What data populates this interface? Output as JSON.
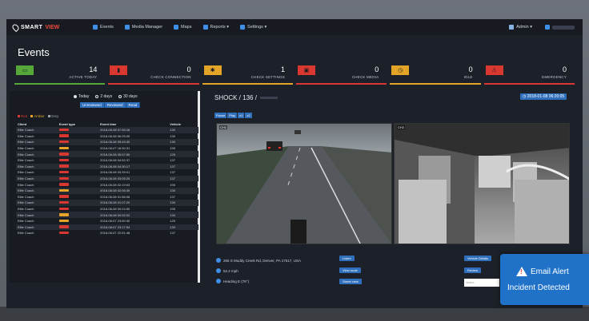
{
  "app": {
    "logo_a": "SMART",
    "logo_b": "VIEW",
    "icon": "map-pin-icon"
  },
  "nav": {
    "items": [
      {
        "label": "Events",
        "icon": "events-icon"
      },
      {
        "label": "Media Manager",
        "icon": "media-icon"
      },
      {
        "label": "Maps",
        "icon": "map-icon"
      },
      {
        "label": "Reports ▾",
        "icon": "reports-icon"
      },
      {
        "label": "Settings ▾",
        "icon": "settings-icon"
      }
    ],
    "admin": "Admin ▾"
  },
  "page": {
    "title": "Events"
  },
  "stats": [
    {
      "value": "14",
      "label": "ACTIVE TODAY",
      "color": "#57a83a"
    },
    {
      "value": "0",
      "label": "CHECK CONNECTION",
      "color": "#d8382f"
    },
    {
      "value": "1",
      "label": "CHECK SETTINGS",
      "color": "#e3a428"
    },
    {
      "value": "0",
      "label": "CHECK MEDIA",
      "color": "#d8382f"
    },
    {
      "value": "0",
      "label": "IDLE",
      "color": "#e3a428"
    },
    {
      "value": "0",
      "label": "EMERGENCY",
      "color": "#d8382f"
    }
  ],
  "filters": {
    "options": [
      "Today",
      "2 days",
      "30 days"
    ],
    "selected": 0
  },
  "tabs": [
    "Unreviewed",
    "Reviewed",
    "Read"
  ],
  "legend": [
    {
      "label": "Red",
      "color": "#d8382f"
    },
    {
      "label": "Amber",
      "color": "#e3a428"
    },
    {
      "label": "Grey",
      "color": "#9aa1aa"
    }
  ],
  "table": {
    "headers": [
      "Client",
      "Event type",
      "Event time",
      "Vehicle"
    ],
    "rows": [
      {
        "client": "Elite Coach",
        "type": "red",
        "time": "2018-08-08 07:30:16",
        "vehicle": "130"
      },
      {
        "client": "Elite Coach",
        "type": "red",
        "time": "2018-08-08 06:25:05",
        "vehicle": "130"
      },
      {
        "client": "Elite Coach",
        "type": "red",
        "time": "2018-08-08 05:45:30",
        "vehicle": "130"
      },
      {
        "client": "Elite Coach",
        "type": "amb",
        "time": "2018-08-07 18:30:31",
        "vehicle": "195"
      },
      {
        "client": "Elite Coach",
        "type": "red",
        "time": "2018-08-08 05:07:50",
        "vehicle": "125"
      },
      {
        "client": "Elite Coach",
        "type": "red",
        "time": "2018-08-08 04:52:37",
        "vehicle": "137"
      },
      {
        "client": "Elite Coach",
        "type": "red",
        "time": "2018-08-08 04:30:17",
        "vehicle": "137"
      },
      {
        "client": "Elite Coach",
        "type": "red",
        "time": "2018-08-08 03:39:01",
        "vehicle": "137"
      },
      {
        "client": "Elite Coach",
        "type": "red",
        "time": "2018-08-08 03:05:20",
        "vehicle": "137"
      },
      {
        "client": "Elite Coach",
        "type": "red",
        "time": "2018-08-08 02:19:03",
        "vehicle": "195"
      },
      {
        "client": "Elite Coach",
        "type": "amb",
        "time": "2018-08-08 02:06:30",
        "vehicle": "130"
      },
      {
        "client": "Elite Coach",
        "type": "red",
        "time": "2018-08-08 01:56:06",
        "vehicle": "137"
      },
      {
        "client": "Elite Coach",
        "type": "red",
        "time": "2018-08-08 01:07:20",
        "vehicle": "130"
      },
      {
        "client": "Elite Coach",
        "type": "red",
        "time": "2018-08-08 00:24:50",
        "vehicle": "195"
      },
      {
        "client": "Elite Coach",
        "type": "amb",
        "time": "2018-08-08 00:02:02",
        "vehicle": "130"
      },
      {
        "client": "Elite Coach",
        "type": "amb",
        "time": "2018-08-07 23:50:30",
        "vehicle": "125"
      },
      {
        "client": "Elite Coach",
        "type": "red",
        "time": "2018-08-07 23:17:54",
        "vehicle": "130"
      },
      {
        "client": "Elite Coach",
        "type": "red",
        "time": "2018-08-07 22:51:48",
        "vehicle": "137"
      }
    ]
  },
  "event": {
    "title": "SHOCK / 136 /",
    "date": "2018-01-08 06:20:05",
    "controls": [
      "Pause",
      "Play",
      "x1",
      "x2"
    ],
    "cam1": "CH1",
    "cam2": "CH2",
    "address": "265 S Muddy Creek Rd, Denver, PA 17517, USA",
    "speed": "52.2 mph",
    "heading": "Heading E (76°)",
    "actions": [
      "Listen",
      "View route",
      "Street view"
    ],
    "right_actions": [
      "Vehicle Details",
      "Review"
    ],
    "notes_placeholder": "Notes"
  },
  "alert": {
    "line1": "Email Alert",
    "line2": "Incident Detected",
    "icon": "warning-icon"
  }
}
